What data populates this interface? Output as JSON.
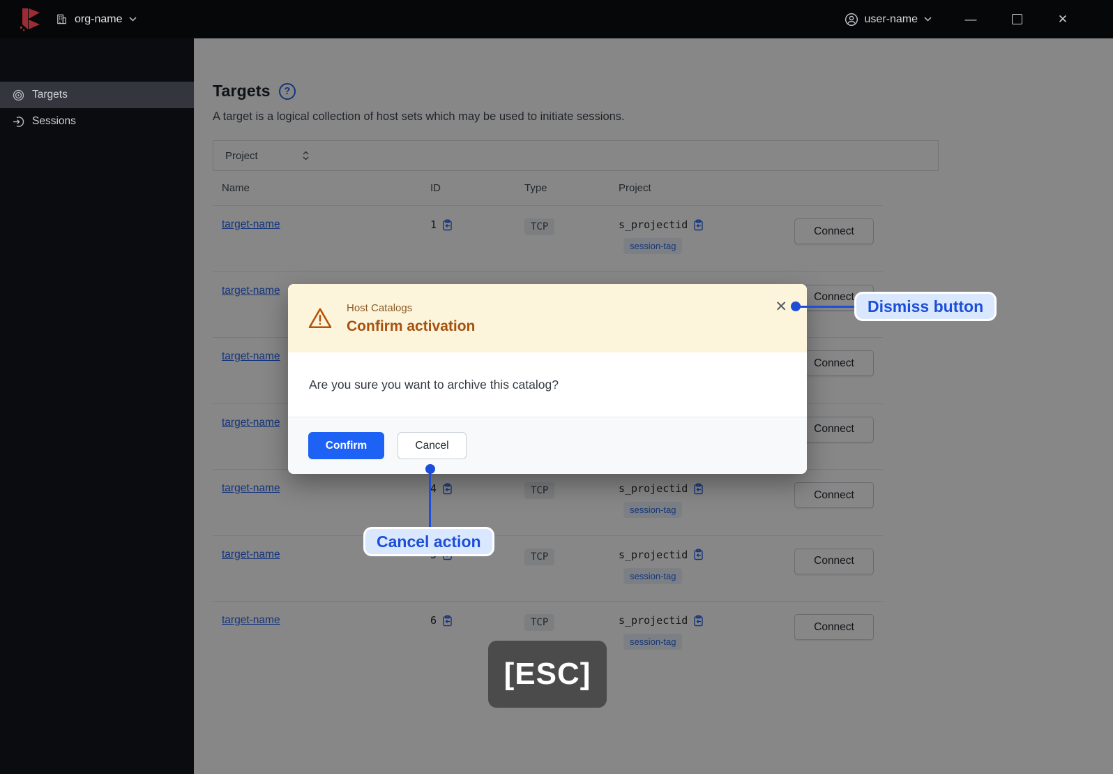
{
  "topbar": {
    "org_name": "org-name",
    "user_name": "user-name"
  },
  "window_controls": {
    "minimize_glyph": "—",
    "close_glyph": "✕"
  },
  "sidebar": {
    "items": [
      {
        "label": "Targets",
        "active": true
      },
      {
        "label": "Sessions",
        "active": false
      }
    ]
  },
  "page": {
    "title": "Targets",
    "help_glyph": "?",
    "description": "A target is a logical collection of host sets which may be used to initiate sessions."
  },
  "filter": {
    "label": "Project"
  },
  "table": {
    "columns": [
      "Name",
      "ID",
      "Type",
      "Project"
    ],
    "connect_label": "Connect",
    "rows": [
      {
        "name": "target-name",
        "id": "1",
        "type": "TCP",
        "project": "s_projectid",
        "tag": "session-tag"
      },
      {
        "name": "target-name",
        "id": "",
        "type": "",
        "project": "",
        "tag": ""
      },
      {
        "name": "target-name",
        "id": "",
        "type": "",
        "project": "",
        "tag": ""
      },
      {
        "name": "target-name",
        "id": "",
        "type": "",
        "project": "",
        "tag": ""
      },
      {
        "name": "target-name",
        "id": "4",
        "type": "TCP",
        "project": "s_projectid",
        "tag": "session-tag"
      },
      {
        "name": "target-name",
        "id": "5",
        "type": "TCP",
        "project": "s_projectid",
        "tag": "session-tag"
      },
      {
        "name": "target-name",
        "id": "6",
        "type": "TCP",
        "project": "s_projectid",
        "tag": "session-tag"
      }
    ]
  },
  "modal": {
    "tagline": "Host Catalogs",
    "title": "Confirm activation",
    "message": "Are you sure you want to archive this catalog?",
    "confirm_label": "Confirm",
    "cancel_label": "Cancel",
    "close_glyph": "✕"
  },
  "annotations": {
    "dismiss_label": "Dismiss button",
    "cancel_label": "Cancel action",
    "esc_label": "[ESC]"
  },
  "colors": {
    "primary_blue": "#1e61f5",
    "link_blue": "#2563eb",
    "annotation_blue": "#1d4ed8",
    "annotation_pill_bg": "#d9e8ff",
    "warning_header_bg": "#fcf4db",
    "warning_icon": "#b45309",
    "warning_title": "#a6520e",
    "warning_tagline": "#8a5c28",
    "logo_red": "#9b2c35",
    "esc_badge_bg": "#4b4b4b"
  }
}
